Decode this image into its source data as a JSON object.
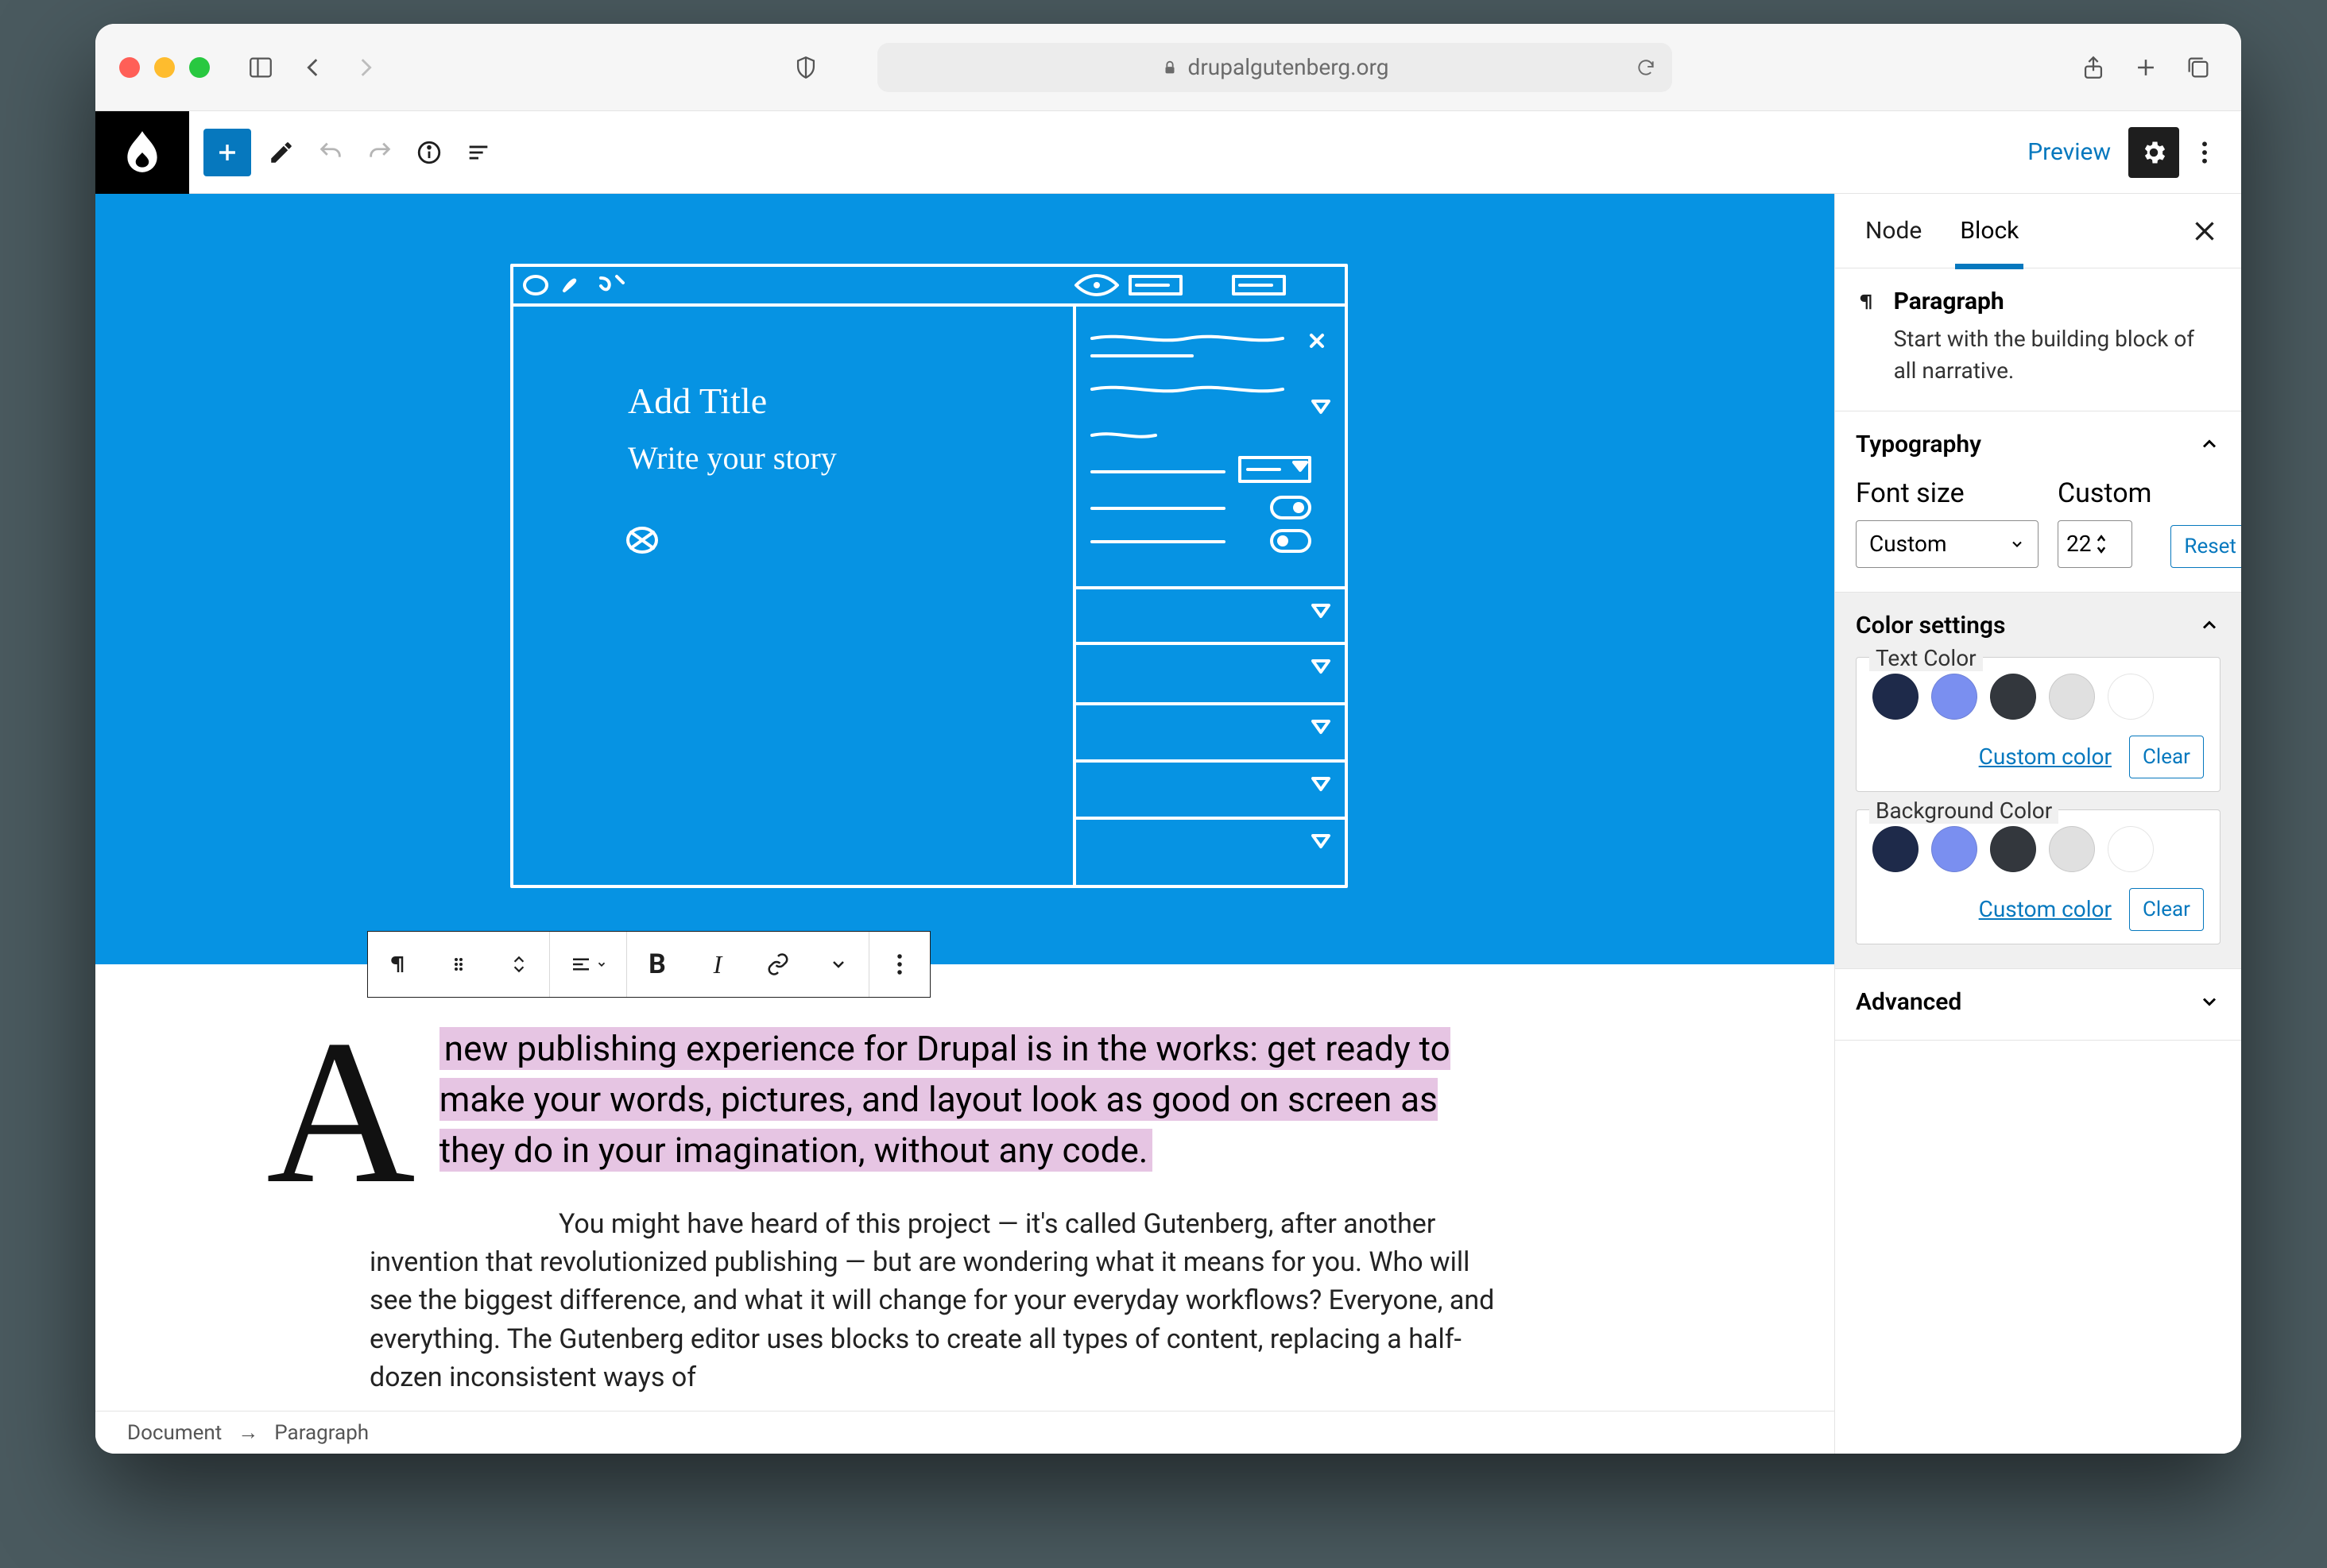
{
  "chrome": {
    "url_host": "drupalgutenberg.org"
  },
  "appbar": {
    "preview": "Preview"
  },
  "sidebar": {
    "tabs": {
      "node": "Node",
      "block": "Block"
    },
    "block_name": "Paragraph",
    "block_desc": "Start with the building block of all narrative.",
    "typography": {
      "title": "Typography",
      "font_size_label": "Font size",
      "custom_label": "Custom",
      "select_value": "Custom",
      "custom_value": "22",
      "reset": "Reset"
    },
    "color": {
      "title": "Color settings",
      "text_legend": "Text Color",
      "bg_legend": "Background Color",
      "custom_link": "Custom color",
      "clear": "Clear",
      "swatches": [
        "#1e2a4a",
        "#7a8ff0",
        "#33373d",
        "#e0e0e0",
        "#ffffff"
      ]
    },
    "advanced": {
      "title": "Advanced"
    }
  },
  "content": {
    "dropcap": "A",
    "lead_hl": " new publishing experience for Drupal is in the works: get ready to make your words, pictures, and layout look as good on screen as they do in your imagination, without any code.",
    "body": "You might have heard of this project — it's called Gutenberg, after another invention that revolutionized publishing — but are wondering what it means for you. Who will see the biggest difference, and what it will change for your everyday workflows? Everyone, and everything. The Gutenberg editor uses blocks to create all types of content, replacing a half-dozen inconsistent ways of"
  },
  "breadcrumb": {
    "a": "Document",
    "b": "Paragraph"
  },
  "sketch": {
    "t1": "Add Title",
    "t2": "Write your story"
  }
}
